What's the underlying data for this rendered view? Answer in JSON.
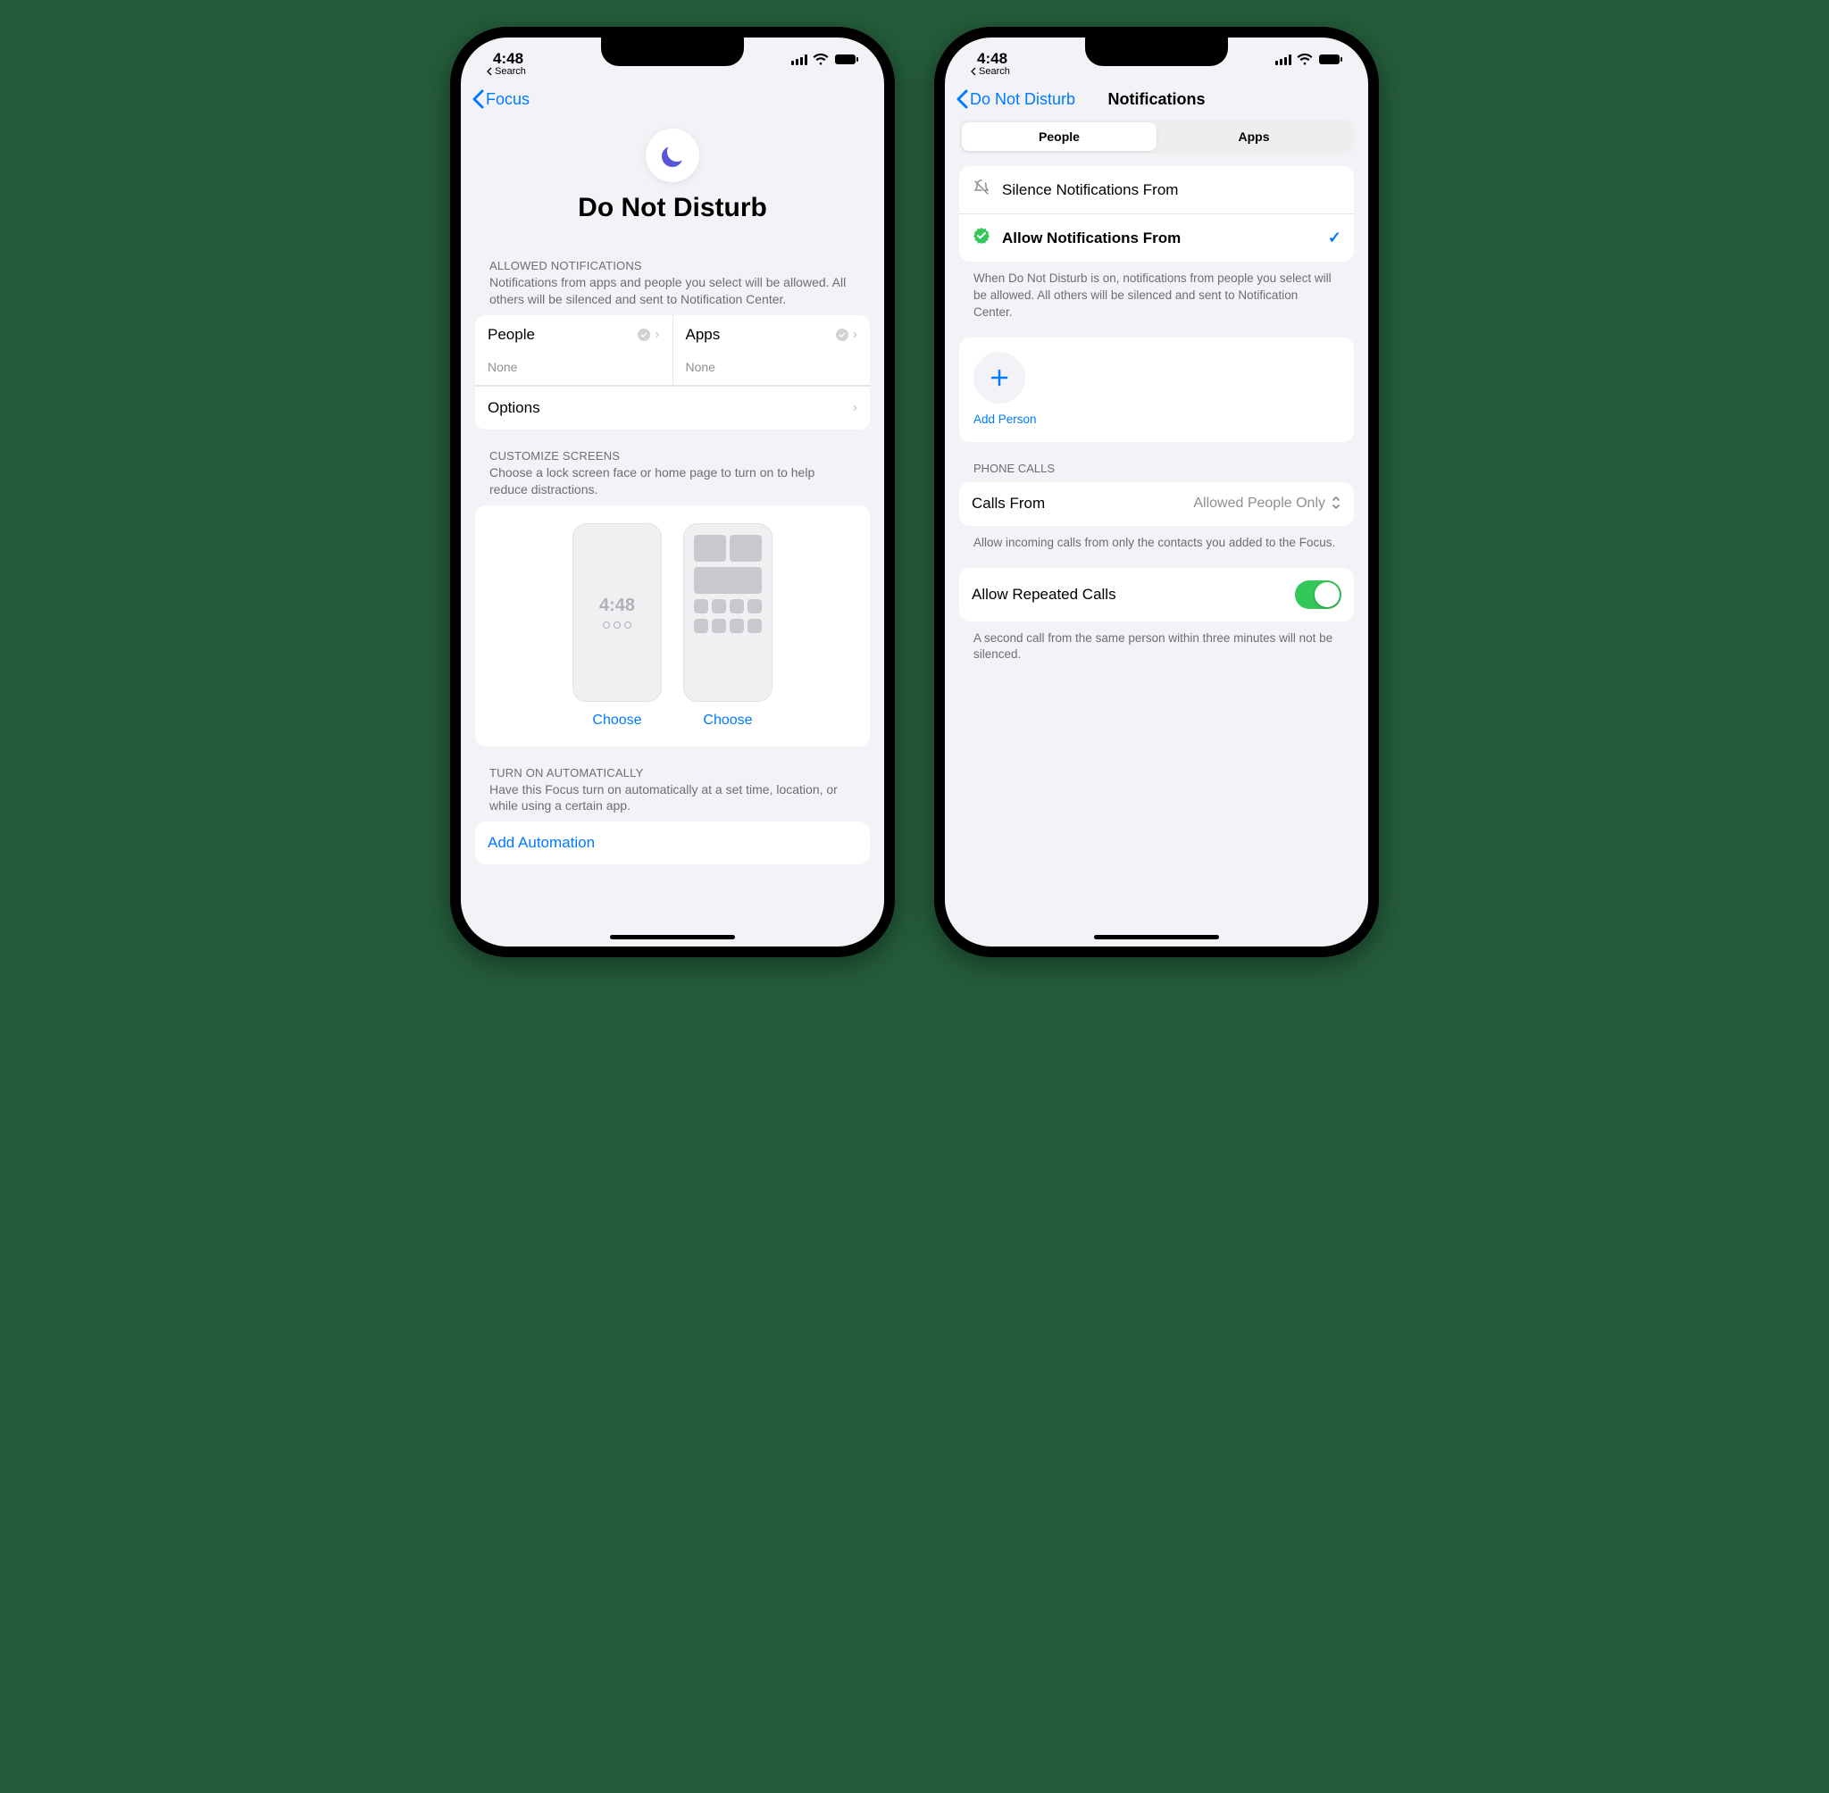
{
  "status": {
    "time": "4:48",
    "back_search": "Search"
  },
  "left": {
    "nav_back": "Focus",
    "hero_title": "Do Not Disturb",
    "allowed": {
      "header": "ALLOWED NOTIFICATIONS",
      "sub": "Notifications from apps and people you select will be allowed. All others will be silenced and sent to Notification Center.",
      "people_label": "People",
      "people_value": "None",
      "apps_label": "Apps",
      "apps_value": "None",
      "options": "Options"
    },
    "customize": {
      "header": "CUSTOMIZE SCREENS",
      "sub": "Choose a lock screen face or home page to turn on to help reduce distractions.",
      "lock_time": "4:48",
      "choose": "Choose"
    },
    "auto": {
      "header": "TURN ON AUTOMATICALLY",
      "sub": "Have this Focus turn on automatically at a set time, location, or while using a certain app.",
      "add": "Add Automation"
    }
  },
  "right": {
    "nav_back": "Do Not Disturb",
    "nav_title": "Notifications",
    "segments": {
      "people": "People",
      "apps": "Apps"
    },
    "silence": "Silence Notifications From",
    "allow": "Allow Notifications From",
    "allow_footer": "When Do Not Disturb is on, notifications from people you select will be allowed. All others will be silenced and sent to Notification Center.",
    "add_person": "Add Person",
    "phone_calls_header": "PHONE CALLS",
    "calls_from_label": "Calls From",
    "calls_from_value": "Allowed People Only",
    "calls_footer": "Allow incoming calls from only the contacts you added to the Focus.",
    "repeated_label": "Allow Repeated Calls",
    "repeated_footer": "A second call from the same person within three minutes will not be silenced."
  }
}
